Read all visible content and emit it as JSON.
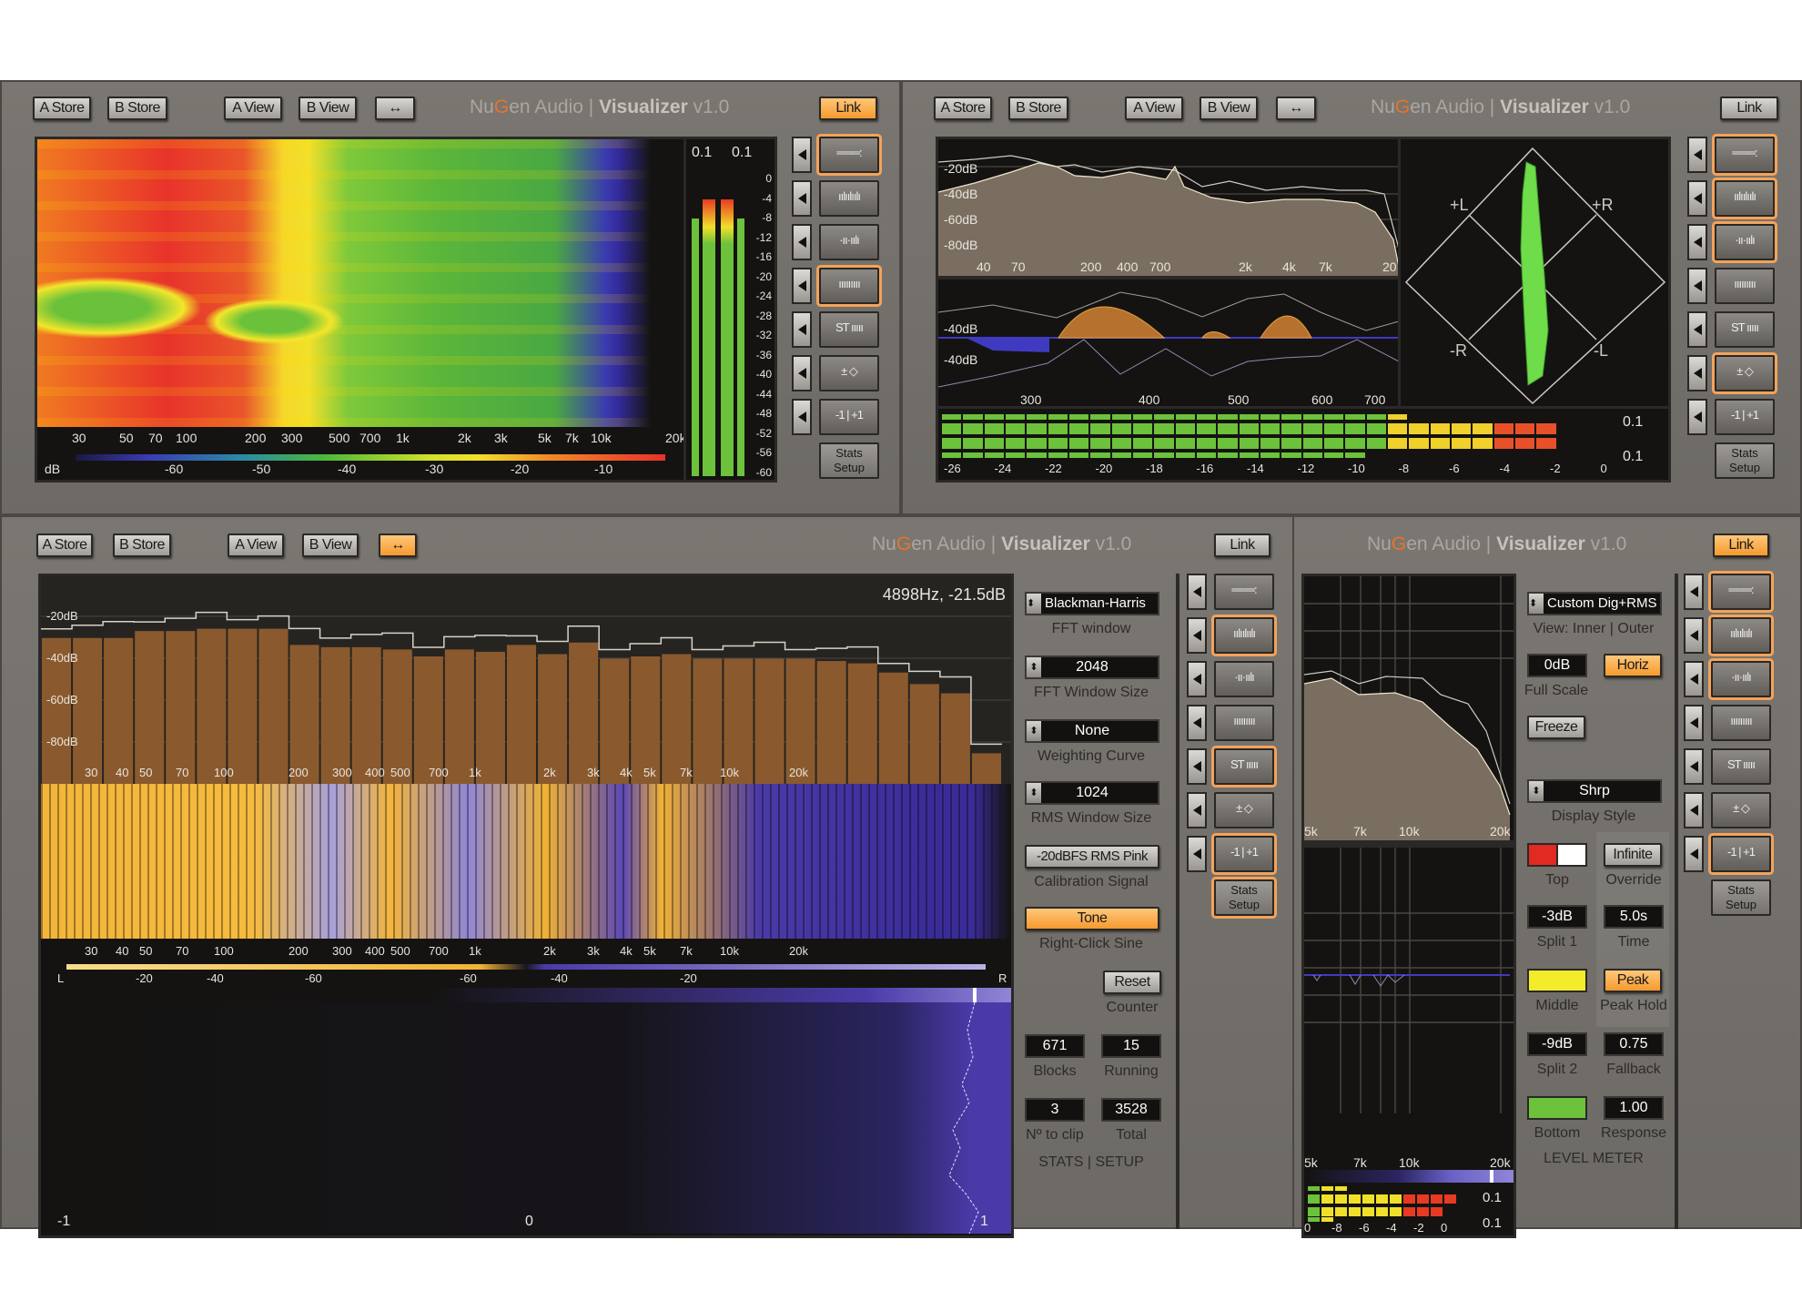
{
  "toolbar": {
    "a_store": "A Store",
    "b_store": "B Store",
    "a_view": "A View",
    "b_view": "B View",
    "swap": "↔",
    "link": "Link"
  },
  "brand": {
    "nu": "Nu",
    "g": "G",
    "rest": "en Audio | ",
    "product": "Visualizer",
    "version": " v1.0"
  },
  "side_buttons": {
    "icons": [
      "meters-icon",
      "spectrum-bars-icon",
      "spectrum-diff-icon",
      "spectrogram-icon",
      "stereo-spectrogram-icon",
      "vectorscope-icon",
      "correlation-icon"
    ],
    "glyphs": [
      "═══:",
      "ıılıılıılı",
      "·ıı·ıılı",
      "ııııııııı",
      "ST ııııı",
      "± ◇",
      "-1 | +1"
    ],
    "stats_setup": "Stats Setup"
  },
  "panel1": {
    "spectrogram_freq_ticks": [
      "30",
      "50",
      "70",
      "100",
      "200",
      "300",
      "500",
      "700",
      "1k",
      "2k",
      "3k",
      "5k",
      "7k",
      "10k",
      "20k"
    ],
    "colorbar_label": "dB",
    "colorbar_ticks": [
      "-60",
      "-50",
      "-40",
      "-30",
      "-20",
      "-10"
    ],
    "meter_peaks": [
      "0.1",
      "0.1"
    ],
    "meter_scale": [
      "0",
      "-4",
      "-8",
      "-12",
      "-16",
      "-20",
      "-24",
      "-28",
      "-32",
      "-36",
      "-40",
      "-44",
      "-48",
      "-52",
      "-56",
      "-60"
    ],
    "meter_levels": [
      -8,
      -4,
      -4,
      -8
    ],
    "active_views": [
      0,
      3
    ]
  },
  "panel2": {
    "spectrum_db": [
      "-20dB",
      "-40dB",
      "-60dB",
      "-80dB"
    ],
    "spectrum_freq": [
      "40",
      "70",
      "200",
      "400",
      "700",
      "2k",
      "4k",
      "7k",
      "20"
    ],
    "diff_db": [
      "-40dB",
      "-40dB"
    ],
    "diff_freq": [
      "300",
      "400",
      "500",
      "600",
      "700"
    ],
    "vector_labels": {
      "pl": "+L",
      "pr": "+R",
      "nr": "-R",
      "nl": "-L"
    },
    "meter_scale": [
      "-26",
      "-24",
      "-22",
      "-20",
      "-18",
      "-16",
      "-14",
      "-12",
      "-10",
      "-8",
      "-6",
      "-4",
      "-2",
      "0"
    ],
    "meter_peaks": [
      "0.1",
      "0.1"
    ],
    "meter_levels": [
      -7,
      -1.2,
      -1.3,
      -9
    ],
    "active_views": [
      0,
      1,
      2,
      5
    ]
  },
  "panel3": {
    "readout": "4898Hz, -21.5dB",
    "bars_db": [
      "-20dB",
      "-40dB",
      "-60dB",
      "-80dB"
    ],
    "bars_freq": [
      "30",
      "40",
      "50",
      "70",
      "100",
      "200",
      "300",
      "400",
      "500",
      "700",
      "1k",
      "2k",
      "3k",
      "4k",
      "5k",
      "7k",
      "10k",
      "20k"
    ],
    "bars_values_db": [
      -22,
      -22,
      -22,
      -19,
      -19,
      -18,
      -18,
      -18,
      -25,
      -26,
      -26,
      -27,
      -30,
      -27,
      -28,
      -25,
      -29,
      -24,
      -31,
      -30,
      -29,
      -31,
      -31,
      -31,
      -31,
      -32,
      -33,
      -37,
      -42,
      -46,
      -72
    ],
    "st_freq": [
      "30",
      "40",
      "50",
      "70",
      "100",
      "200",
      "300",
      "400",
      "500",
      "700",
      "1k",
      "2k",
      "3k",
      "4k",
      "5k",
      "7k",
      "10k",
      "20k"
    ],
    "balance_ticks": [
      "L",
      "-20",
      "-40",
      "-60",
      "-60",
      "-40",
      "-20",
      "R"
    ],
    "corr_ticks": [
      "-1",
      "0",
      "1"
    ],
    "settings": {
      "fft_window": "Blackman-Harris",
      "fft_window_label": "FFT window",
      "fft_size": "2048",
      "fft_size_label": "FFT Window Size",
      "weighting": "None",
      "weighting_label": "Weighting Curve",
      "rms_size": "1024",
      "rms_size_label": "RMS Window Size",
      "calibration": "-20dBFS RMS Pink",
      "calibration_label": "Calibration Signal",
      "tone": "Tone",
      "tone_label": "Right-Click Sine",
      "reset": "Reset",
      "reset_label": "Counter",
      "blocks": "671",
      "blocks_label": "Blocks",
      "running": "15",
      "running_label": "Running",
      "to_clip": "3",
      "to_clip_label": "Nº to clip",
      "total": "3528",
      "total_label": "Total",
      "footer": "STATS | SETUP"
    },
    "active_views": [
      1,
      4,
      6,
      7
    ]
  },
  "panel4": {
    "freq": [
      "5k",
      "7k",
      "10k",
      "20k"
    ],
    "meter_scale": [
      "0",
      "-8",
      "-6",
      "-4",
      "-2",
      "0"
    ],
    "meter_peaks": [
      "0.1",
      "0.1"
    ],
    "settings": {
      "scale": "Custom Dig+RMS",
      "scale_label": "View: Inner | Outer",
      "full_scale": "0dB",
      "horiz": "Horiz",
      "full_scale_label": "Full Scale",
      "freeze": "Freeze",
      "display_style": "Shrp",
      "display_style_label": "Display Style",
      "top_label": "Top",
      "infinite": "Infinite",
      "override_label": "Override",
      "split1": "-3dB",
      "split1_label": "Split 1",
      "time": "5.0s",
      "time_label": "Time",
      "middle_label": "Middle",
      "peak": "Peak",
      "peak_hold_label": "Peak Hold",
      "split2": "-9dB",
      "split2_label": "Split 2",
      "fallback": "0.75",
      "fallback_label": "Fallback",
      "bottom_label": "Bottom",
      "response": "1.00",
      "response_label": "Response",
      "footer": "LEVEL METER",
      "colors": {
        "top_a": "#e02a22",
        "top_b": "#ffffff",
        "middle": "#f2ec2a",
        "bottom": "#6cc23a"
      }
    },
    "active_views": [
      0,
      1,
      2,
      6
    ]
  },
  "colors": {
    "accent": "#f59a2e",
    "panel": "#75716c",
    "screen": "#141311",
    "bar": "#8a5a2e",
    "spectrum_fill": "#7a6e60",
    "vector": "#6fdc4a"
  }
}
